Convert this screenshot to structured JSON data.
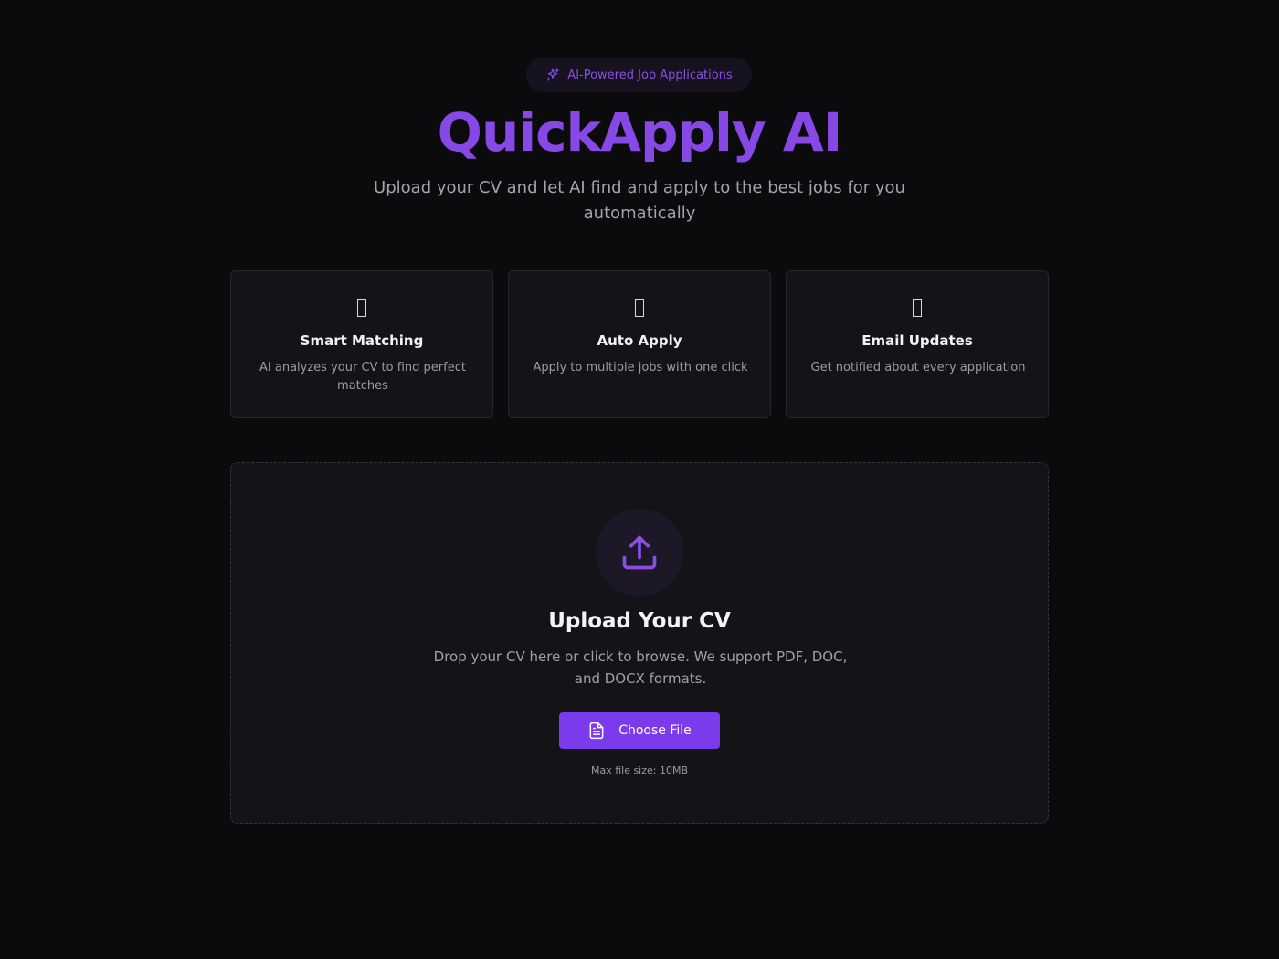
{
  "hero": {
    "badge_label": "AI-Powered Job Applications",
    "badge_icon": "sparkles-icon",
    "title": "QuickApply AI",
    "subtitle": "Upload your CV and let AI find and apply to the best jobs for you automatically"
  },
  "features": [
    {
      "icon": "placeholder-glyph",
      "title": "Smart Matching",
      "description": "AI analyzes your CV to find perfect matches"
    },
    {
      "icon": "placeholder-glyph",
      "title": "Auto Apply",
      "description": "Apply to multiple jobs with one click"
    },
    {
      "icon": "placeholder-glyph",
      "title": "Email Updates",
      "description": "Get notified about every application"
    }
  ],
  "upload": {
    "icon": "upload-icon",
    "title": "Upload Your CV",
    "description": "Drop your CV here or click to browse. We support PDF, DOC, and DOCX formats.",
    "button_label": "Choose File",
    "button_icon": "file-text-icon",
    "max_size": "Max file size: 10MB"
  },
  "colors": {
    "accent": "#7c3aed",
    "title": "#8748e6",
    "background": "#0b0b0e",
    "card": "#131318"
  }
}
